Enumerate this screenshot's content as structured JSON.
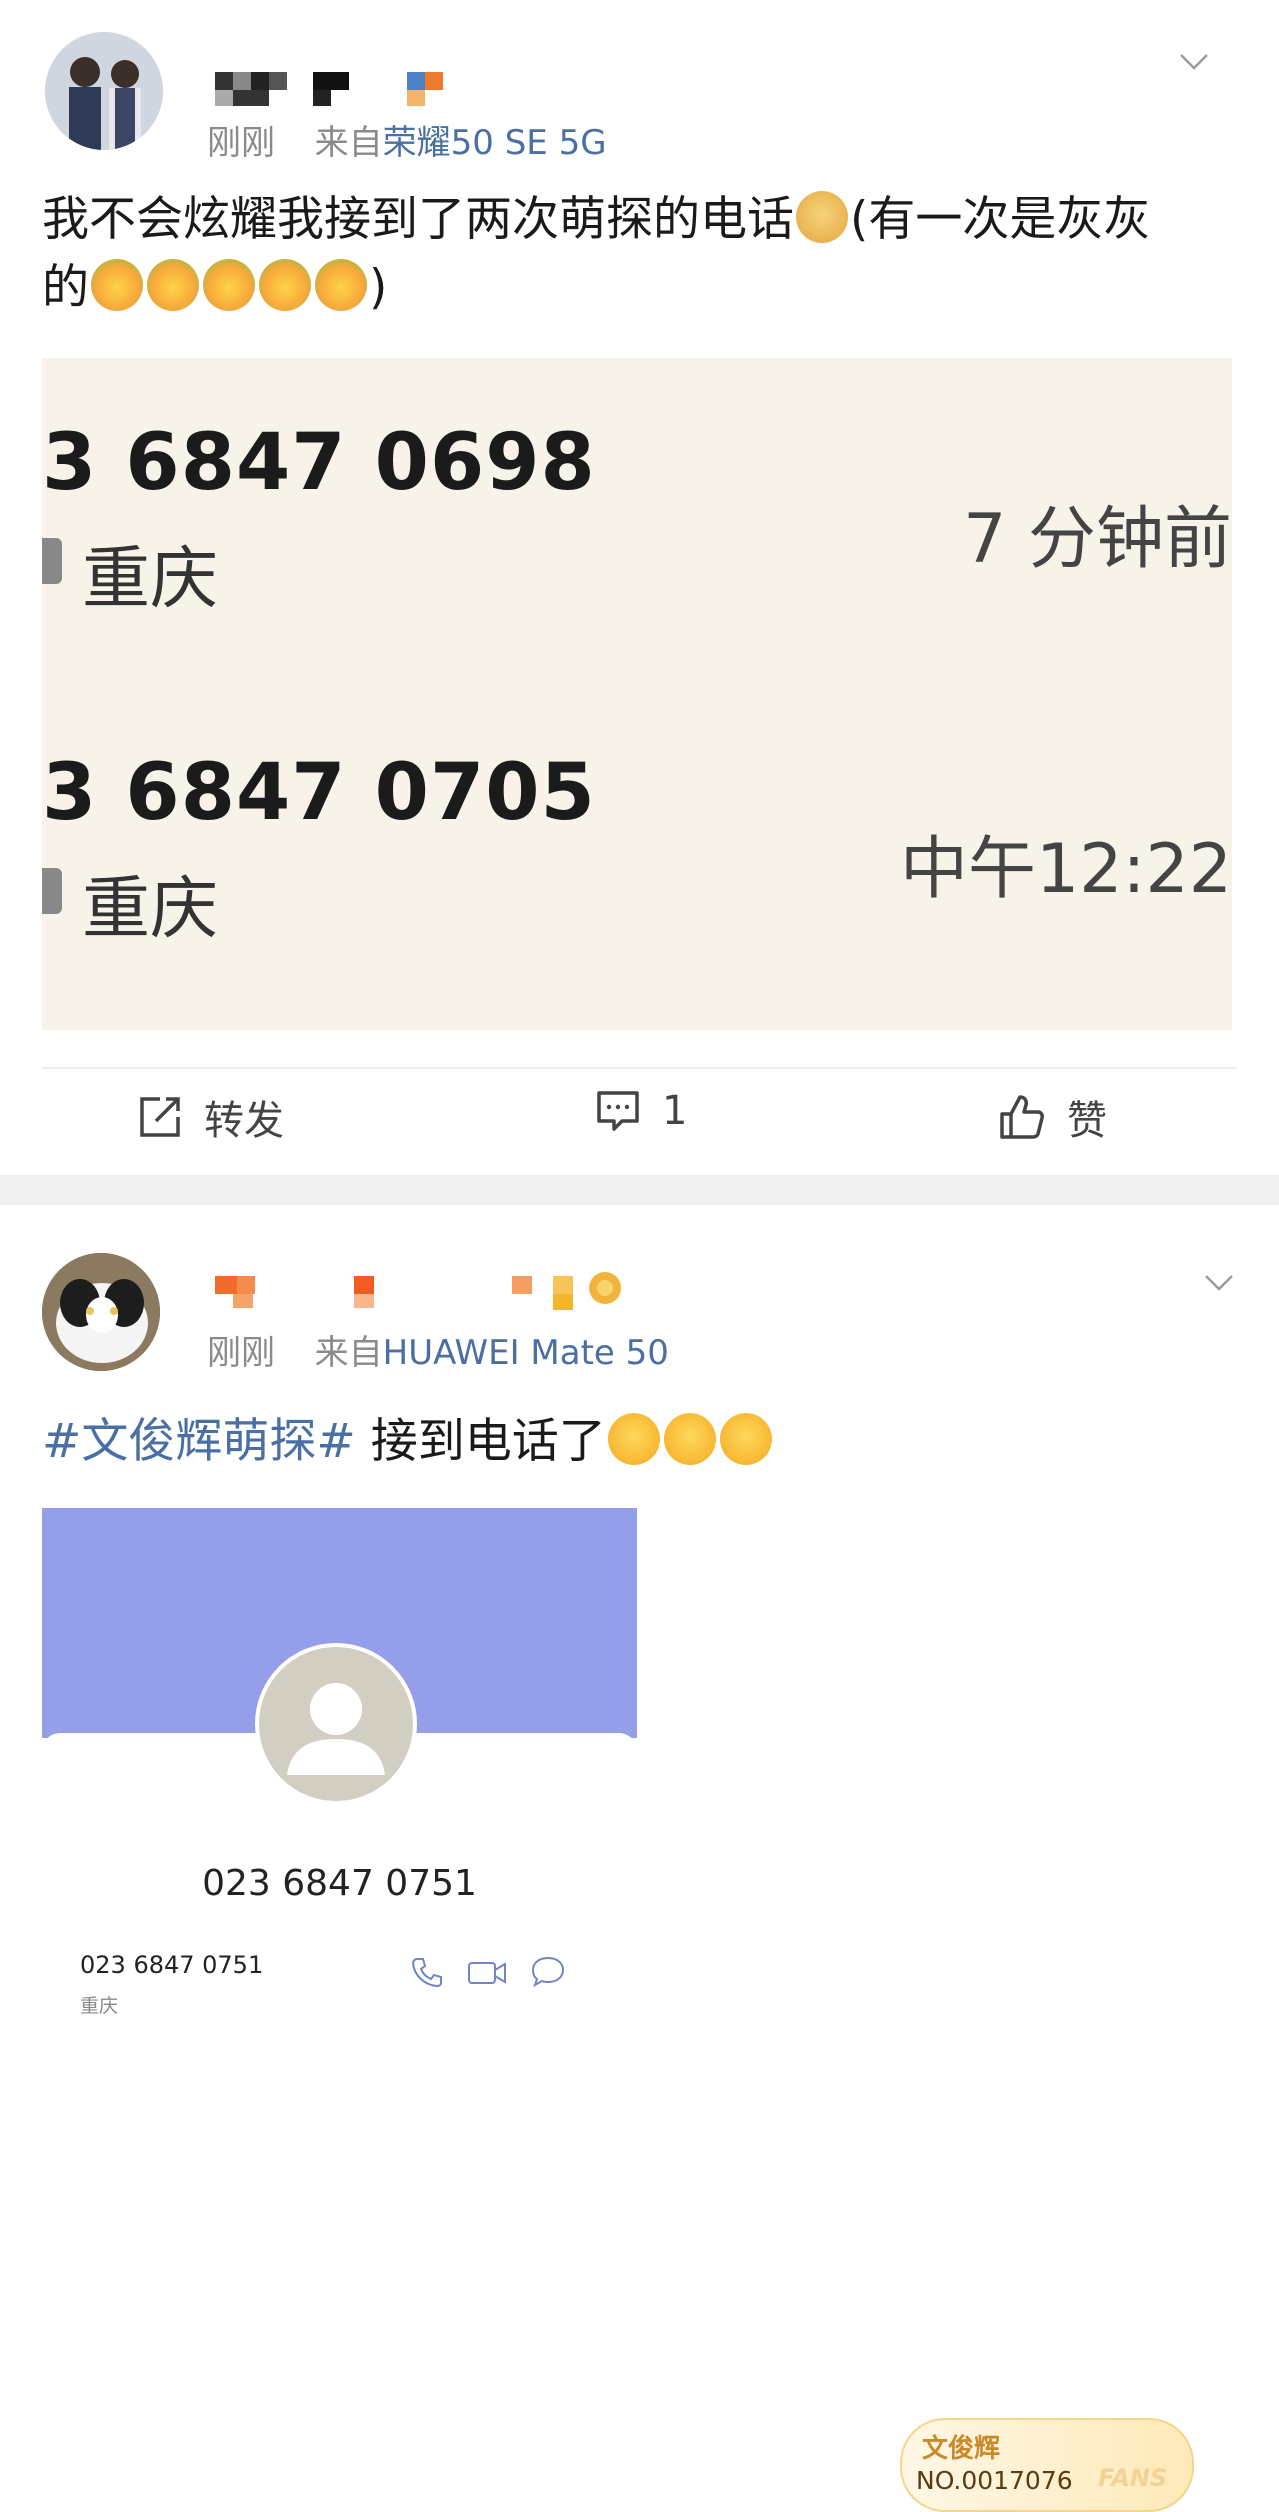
{
  "post1": {
    "time": "刚刚",
    "source_prefix": "来自",
    "source_device": "荣耀50 SE 5G",
    "text_main": "我不会炫耀我接到了两次萌探的电话",
    "text_paren": "(有一次是灰灰",
    "text_de": "的",
    "text_close": ")",
    "emoji_doge": "doge-emoji",
    "emoji_flower": "flower-face-emoji",
    "screenshot": {
      "call1_number": "3 6847 0698",
      "call1_city": "重庆",
      "call1_time": "7 分钟前",
      "call2_number": "3 6847 0705",
      "call2_city": "重庆",
      "call2_time": "中午12:22"
    },
    "actions": {
      "repost_label": "转发",
      "comment_count": "1",
      "like_label": "赞"
    }
  },
  "post2": {
    "time": "刚刚",
    "source_prefix": "来自",
    "source_device": "HUAWEI Mate 50",
    "hashtag": "#文俊辉萌探#",
    "text": " 接到电话了",
    "emoji_face": "hand-over-mouth-emoji",
    "badge": {
      "name": "文俊辉",
      "number": "NO.0017076",
      "fans": "FANS"
    },
    "screenshot": {
      "big_number": "023 6847 0751",
      "small_number": "023 6847 0751",
      "city": "重庆"
    }
  },
  "colors": {
    "link": "#4a6fa5",
    "meta_gray": "#8a8a8a",
    "card_bg": "#f7f3e8",
    "band_purple": "#949ee9"
  }
}
